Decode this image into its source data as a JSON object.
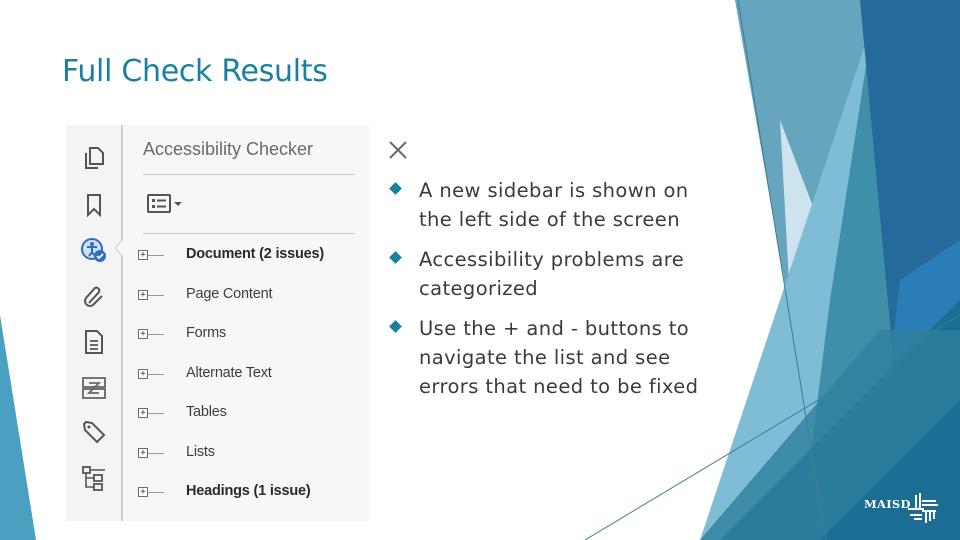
{
  "slide": {
    "title": "Full Check Results",
    "accent_color": "#1a7fa1"
  },
  "screenshot": {
    "rail_icons": [
      {
        "name": "pages-icon"
      },
      {
        "name": "bookmark-icon"
      },
      {
        "name": "accessibility-icon",
        "active": true
      },
      {
        "name": "attachment-icon"
      },
      {
        "name": "document-properties-icon"
      },
      {
        "name": "content-order-icon"
      },
      {
        "name": "tags-icon"
      },
      {
        "name": "structure-tree-icon"
      }
    ],
    "panel_title": "Accessibility Checker",
    "close_icon": "close-icon",
    "options_icon": "options-menu-icon",
    "tree_items": [
      {
        "label": "Document (2 issues)",
        "bold": true,
        "expander": "+"
      },
      {
        "label": "Page Content",
        "bold": false,
        "expander": "+"
      },
      {
        "label": "Forms",
        "bold": false,
        "expander": "+"
      },
      {
        "label": "Alternate Text",
        "bold": false,
        "expander": "+"
      },
      {
        "label": "Tables",
        "bold": false,
        "expander": "+"
      },
      {
        "label": "Lists",
        "bold": false,
        "expander": "+"
      },
      {
        "label": "Headings (1 issue)",
        "bold": true,
        "expander": "+"
      }
    ]
  },
  "bullets": [
    {
      "text": "A new sidebar is shown on the left side of the screen"
    },
    {
      "text": "Accessibility problems are categorized"
    },
    {
      "text": "Use the + and - buttons to navigate the list and see errors that need to be fixed"
    }
  ],
  "logo": {
    "text": "MAISD"
  },
  "theme_colors": {
    "dark_blue": "#236a9c",
    "teal": "#3f8fa8",
    "light_blue": "#86c0d8",
    "pale_blue": "#cce3ee",
    "mid_blue": "#5fa2bb"
  }
}
